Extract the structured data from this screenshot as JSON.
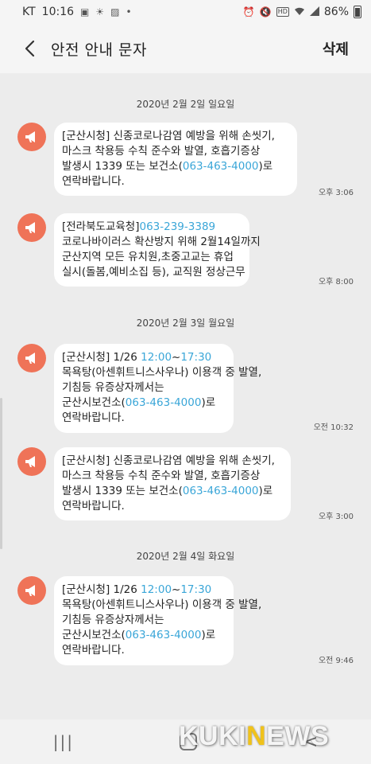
{
  "status_bar": {
    "carrier": "KT",
    "time": "10:16",
    "battery": "86%",
    "battery_level": 0.86,
    "left_icons": [
      "notification-icon",
      "sunrise-icon",
      "gallery-icon",
      "dot-icon"
    ],
    "right_icons": [
      "alarm-icon",
      "mute-icon",
      "hd-icon",
      "wifi-icon",
      "signal-icon",
      "battery-icon"
    ],
    "hd_text": "HD"
  },
  "header": {
    "title": "안전 안내 문자",
    "delete_label": "삭제"
  },
  "messages": [
    {
      "date": "2020년 2월 2일 일요일",
      "lines": [
        [
          {
            "t": "[군산시청] 신종코로나감염 예방을 위해 손씻기,"
          }
        ],
        [
          {
            "t": "마스크 착용등 수칙 준수와 발열, 호흡기증상"
          }
        ],
        [
          {
            "t": "발생시 1339 또는 보건소("
          },
          {
            "t": "063-463-4000",
            "link": true
          },
          {
            "t": ")로"
          }
        ],
        [
          {
            "t": "연락바랍니다."
          }
        ]
      ],
      "time": "오후 3:06"
    },
    {
      "lines": [
        [
          {
            "t": "[전라북도교육청]"
          },
          {
            "t": "063-239-3389",
            "link": true
          }
        ],
        [
          {
            "t": "코로나바이러스 확산방지 위해 2월14일까지"
          }
        ],
        [
          {
            "t": "군산지역 모든 유치원,초중고교는 휴업"
          }
        ],
        [
          {
            "t": "실시(돌봄,예비소집 등), 교직원 정상근무"
          }
        ]
      ],
      "time": "오후 8:00"
    },
    {
      "date": "2020년 2월 3일 월요일",
      "lines": [
        [
          {
            "t": "[군산시청] 1/26 "
          },
          {
            "t": "12:00",
            "link": true
          },
          {
            "t": "~"
          },
          {
            "t": "17:30",
            "link": true
          }
        ],
        [
          {
            "t": "목욕탕(아센휘트니스사우나) 이용객 중 발열,"
          }
        ],
        [
          {
            "t": "기침등 유증상자께서는"
          }
        ],
        [
          {
            "t": "군산시보건소("
          },
          {
            "t": "063-463-4000",
            "link": true
          },
          {
            "t": ")로"
          }
        ],
        [
          {
            "t": "연락바랍니다."
          }
        ]
      ],
      "time": "오전 10:32"
    },
    {
      "lines": [
        [
          {
            "t": "[군산시청] 신종코로나감염 예방을 위해 손씻기,"
          }
        ],
        [
          {
            "t": "마스크 착용등 수칙 준수와 발열, 호흡기증상"
          }
        ],
        [
          {
            "t": "발생시 1339 또는 보건소("
          },
          {
            "t": "063-463-4000",
            "link": true
          },
          {
            "t": ")로"
          }
        ],
        [
          {
            "t": "연락바랍니다."
          }
        ]
      ],
      "time": "오후 3:00"
    },
    {
      "date": "2020년 2월 4일 화요일",
      "lines": [
        [
          {
            "t": "[군산시청] 1/26 "
          },
          {
            "t": "12:00",
            "link": true
          },
          {
            "t": "~"
          },
          {
            "t": "17:30",
            "link": true
          }
        ],
        [
          {
            "t": "목욕탕(아센휘트니스사우나) 이용객 중 발열,"
          }
        ],
        [
          {
            "t": "기침등 유증상자께서는"
          }
        ],
        [
          {
            "t": "군산시보건소("
          },
          {
            "t": "063-463-4000",
            "link": true
          },
          {
            "t": ")로"
          }
        ],
        [
          {
            "t": "연락바랍니다."
          }
        ]
      ],
      "time": "오전 9:46"
    }
  ],
  "nav": {
    "recent_icon": "recent-apps-icon",
    "home_icon": "home-icon",
    "back_icon": "back-icon"
  },
  "watermark": {
    "part1": "KUKI",
    "accent": "N",
    "part2": "EWS"
  },
  "colors": {
    "accent_avatar": "#ef7358",
    "link": "#3aa6d8",
    "bubble": "#ffffff",
    "background": "#ececec"
  }
}
